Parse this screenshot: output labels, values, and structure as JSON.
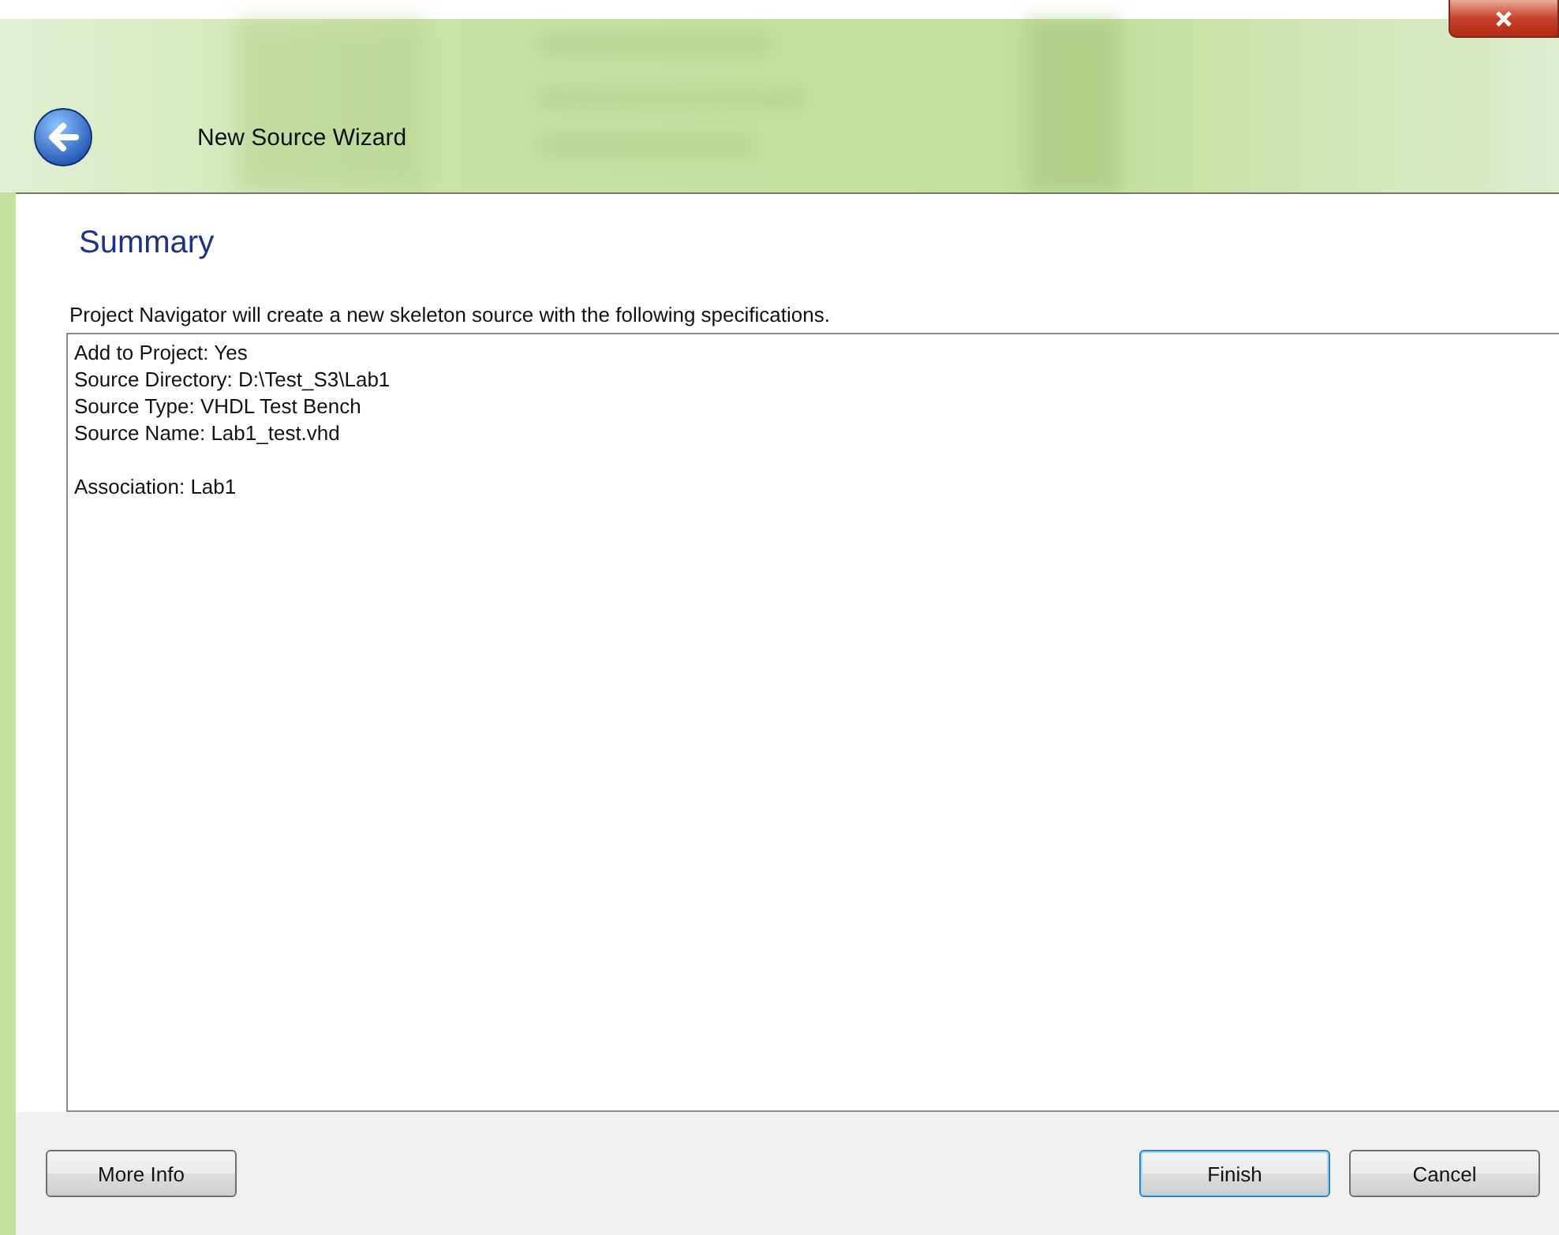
{
  "window": {
    "title": "New Source Wizard"
  },
  "heading": "Summary",
  "description": "Project Navigator will create a new skeleton source with the following specifications.",
  "summary_groups": [
    [
      "Add to Project: Yes",
      "Source Directory: D:\\Test_S3\\Lab1",
      "Source Type: VHDL Test Bench",
      "Source Name: Lab1_test.vhd"
    ],
    [
      "Association: Lab1"
    ]
  ],
  "left_buttons": [
    {
      "label": "More Info",
      "default": false
    }
  ],
  "right_buttons": [
    {
      "label": "Finish",
      "default": true
    },
    {
      "label": "Cancel",
      "default": false
    }
  ]
}
